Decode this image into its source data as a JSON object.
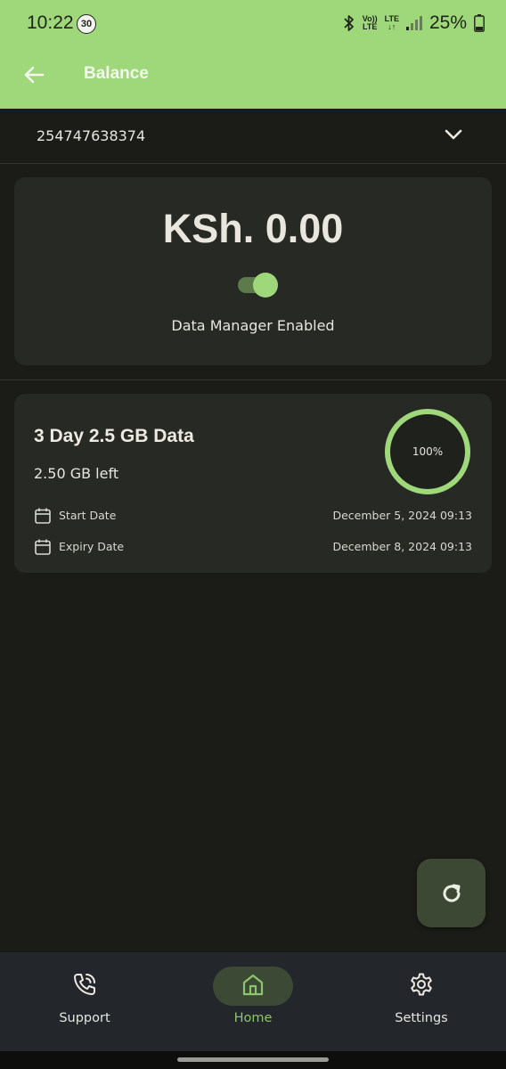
{
  "status_bar": {
    "time": "10:22",
    "notification_count": "30",
    "volte_label": "Vo)) LTE",
    "lte_label": "LTE",
    "battery": "25%"
  },
  "app_bar": {
    "title": "Balance"
  },
  "account": {
    "number": "254747638374"
  },
  "balance": {
    "amount": "KSh. 0.00",
    "toggle_on": true,
    "toggle_label": "Data Manager Enabled"
  },
  "bundle": {
    "name": "3 Day 2.5 GB Data",
    "remaining": "2.50 GB left",
    "percent_label": "100%",
    "percent_value": 100,
    "start_label": "Start Date",
    "start_value": "December 5, 2024 09:13",
    "expiry_label": "Expiry Date",
    "expiry_value": "December 8, 2024 09:13"
  },
  "nav": {
    "items": [
      {
        "label": "Support",
        "icon": "phone-icon"
      },
      {
        "label": "Home",
        "icon": "home-icon",
        "active": true
      },
      {
        "label": "Settings",
        "icon": "gear-icon"
      }
    ]
  },
  "colors": {
    "accent": "#9fd87a",
    "background": "#1b1c18",
    "card": "#272924",
    "nav_background": "#23262b"
  }
}
